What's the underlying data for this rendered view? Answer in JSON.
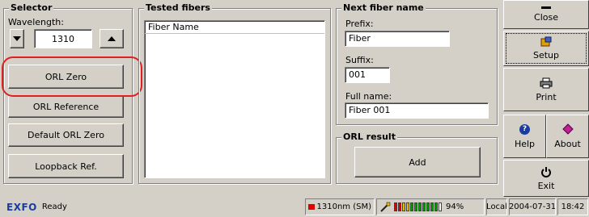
{
  "selector": {
    "title": "Selector",
    "wavelength_label": "Wavelength:",
    "wavelength_value": "1310",
    "buttons": {
      "orl_zero": "ORL Zero",
      "orl_reference": "ORL Reference",
      "default_orl_zero": "Default ORL Zero",
      "loopback_ref": "Loopback Ref."
    }
  },
  "tested_fibers": {
    "title": "Tested fibers",
    "column_header": "Fiber Name",
    "rows": []
  },
  "next_fiber_name": {
    "title": "Next fiber name",
    "prefix_label": "Prefix:",
    "prefix_value": "Fiber",
    "suffix_label": "Suffix:",
    "suffix_value": "001",
    "full_name_label": "Full name:",
    "full_name_value": "Fiber 001"
  },
  "orl_result": {
    "title": "ORL result",
    "add_label": "Add"
  },
  "side_buttons": {
    "close": "Close",
    "setup": "Setup",
    "print": "Print",
    "help": "Help",
    "about": "About",
    "exit": "Exit"
  },
  "status_bar": {
    "brand": "EXFO",
    "status": "Ready",
    "source_label": "1310nm (SM)",
    "battery_percent": "94%",
    "battery_level": 0.94,
    "mode": "Local",
    "date": "2004-07-31",
    "time": "18:42"
  },
  "colors": {
    "background": "#d4d0c8",
    "highlight_circle": "#e02020",
    "brand_blue": "#1a3c9c",
    "source_red": "#e00000",
    "battery_red": "#e00000",
    "battery_yellow": "#e0c000",
    "battery_green": "#00a000"
  }
}
